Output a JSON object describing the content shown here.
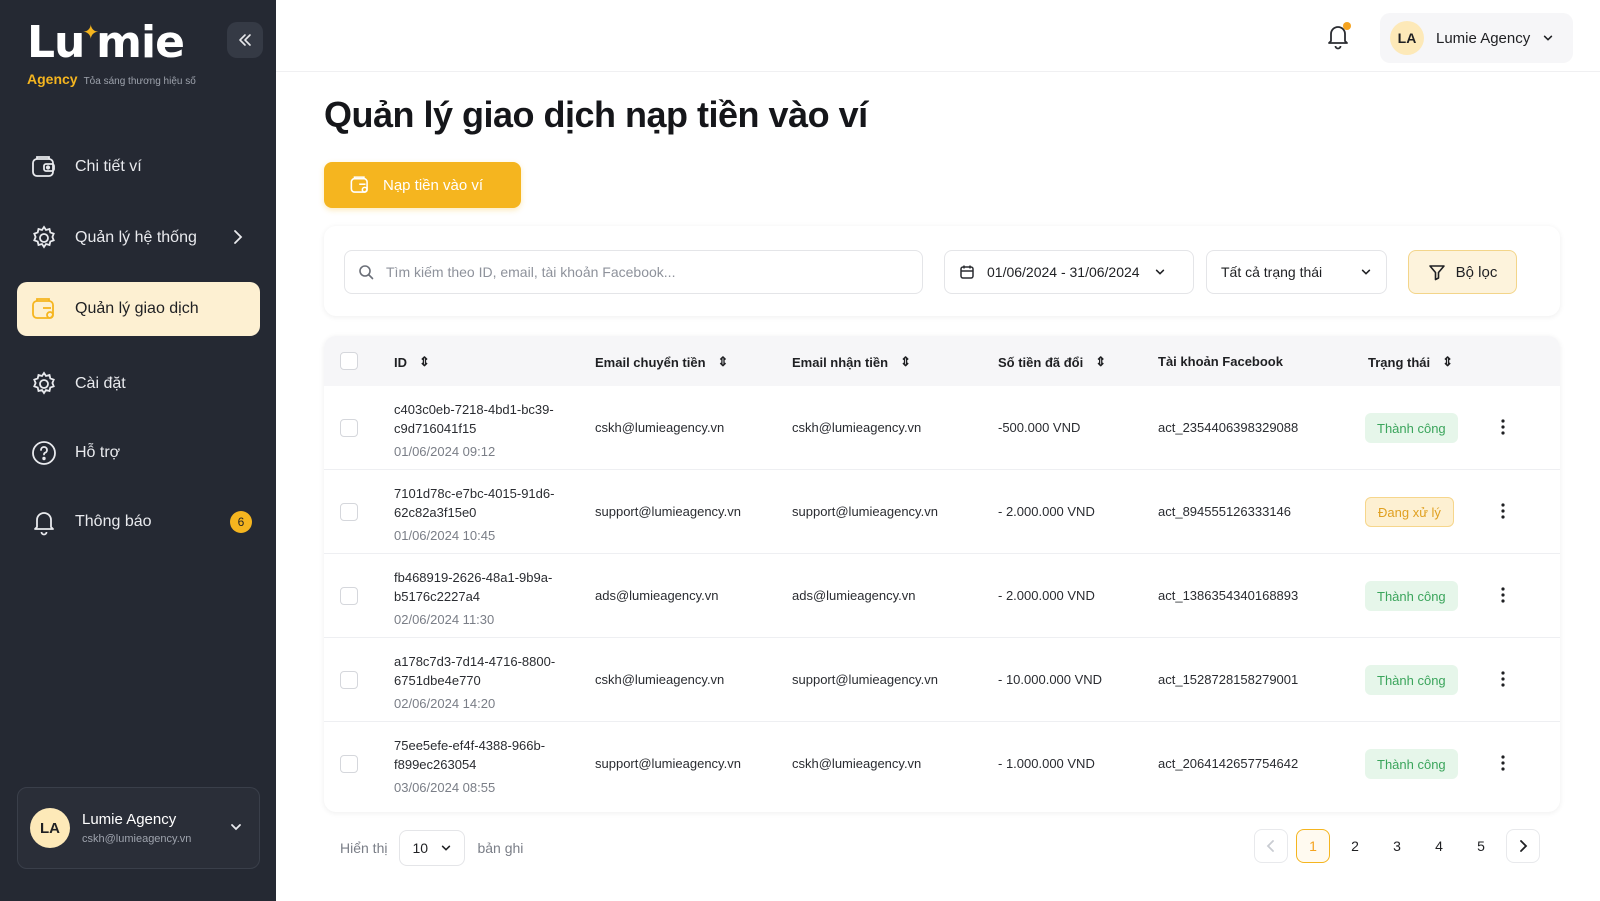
{
  "brand": {
    "name_pre": "Lu",
    "name_post": "mie",
    "agency": "Agency",
    "tagline": "Tỏa sáng thương hiệu số"
  },
  "sidebar": {
    "items": [
      {
        "label": "Chi tiết ví",
        "icon": "wallet-icon"
      },
      {
        "label": "Quản lý hệ thống",
        "icon": "gear-icon"
      },
      {
        "label": "Quản lý giao dịch",
        "icon": "transaction-icon",
        "active": true
      },
      {
        "label": "Cài đặt",
        "icon": "settings-icon"
      },
      {
        "label": "Hỗ trợ",
        "icon": "help-icon"
      },
      {
        "label": "Thông báo",
        "icon": "bell-icon",
        "badge": "6"
      }
    ],
    "user": {
      "initials": "LA",
      "name": "Lumie Agency",
      "email": "cskh@lumieagency.vn"
    }
  },
  "topbar": {
    "account_initials": "LA",
    "account_name": "Lumie Agency"
  },
  "page": {
    "title": "Quản lý giao dịch nạp tiền vào ví",
    "topup_label": "Nạp tiền vào ví"
  },
  "filters": {
    "search_placeholder": "Tìm kiếm theo ID, email, tài khoản Facebook...",
    "date_range": "01/06/2024 - 31/06/2024",
    "status": "Tất cả trạng thái",
    "filter_label": "Bộ lọc"
  },
  "table": {
    "headers": {
      "id": "ID",
      "from": "Email chuyển tiền",
      "to": "Email nhận tiền",
      "amount": "Số tiền đã đổi",
      "fb": "Tài khoản Facebook",
      "status": "Trạng thái"
    },
    "rows": [
      {
        "id1": "c403c0eb-7218-4bd1-bc39-",
        "id2": "c9d716041f15",
        "date": "01/06/2024 09:12",
        "from": "cskh@lumieagency.vn",
        "to": "cskh@lumieagency.vn",
        "amount": "-500.000 VND",
        "fb": "act_2354406398329088",
        "status": "Thành công",
        "state": "ok"
      },
      {
        "id1": "7101d78c-e7bc-4015-91d6-",
        "id2": "62c82a3f15e0",
        "date": "01/06/2024 10:45",
        "from": "support@lumieagency.vn",
        "to": "support@lumieagency.vn",
        "amount": "- 2.000.000 VND",
        "fb": "act_894555126333146",
        "status": "Đang xử lý",
        "state": "proc"
      },
      {
        "id1": "fb468919-2626-48a1-9b9a-",
        "id2": "b5176c2227a4",
        "date": "02/06/2024 11:30",
        "from": "ads@lumieagency.vn",
        "to": "ads@lumieagency.vn",
        "amount": "- 2.000.000 VND",
        "fb": "act_1386354340168893",
        "status": "Thành công",
        "state": "ok"
      },
      {
        "id1": "a178c7d3-7d14-4716-8800-",
        "id2": "6751dbe4e770",
        "date": "02/06/2024 14:20",
        "from": "cskh@lumieagency.vn",
        "to": "support@lumieagency.vn",
        "amount": "- 10.000.000 VND",
        "fb": "act_1528728158279001",
        "status": "Thành công",
        "state": "ok"
      },
      {
        "id1": "75ee5efe-ef4f-4388-966b-",
        "id2": "f899ec263054",
        "date": "03/06/2024 08:55",
        "from": "support@lumieagency.vn",
        "to": "cskh@lumieagency.vn",
        "amount": "- 1.000.000 VND",
        "fb": "act_2064142657754642",
        "status": "Thành công",
        "state": "ok"
      }
    ]
  },
  "pagination": {
    "show_label": "Hiển thị",
    "page_size": "10",
    "records_label": "bản ghi",
    "pages": [
      "1",
      "2",
      "3",
      "4",
      "5"
    ],
    "current": "1"
  },
  "colors": {
    "accent": "#f5b51f",
    "sidebar": "#252933",
    "success": "#3ba55c",
    "pending": "#e0a020"
  }
}
